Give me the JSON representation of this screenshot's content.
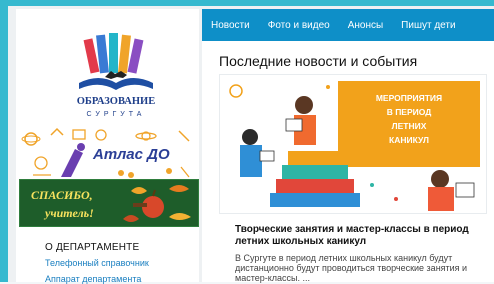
{
  "nav": {
    "items": [
      "Новости",
      "Фото и видео",
      "Анонсы",
      "Пишут дети"
    ]
  },
  "logo": {
    "text_line1": "ОБРАЗОВАНИЕ",
    "text_line2": "СУРГУТА"
  },
  "banners": {
    "atlas": "Атлас ДО",
    "thanks_line1": "СПАСИБО,",
    "thanks_line2": "учитель!"
  },
  "main": {
    "section_title": "Последние новости и события",
    "featured": {
      "image_caption_line1": "МЕРОПРИЯТИЯ",
      "image_caption_line2": "В ПЕРИОД",
      "image_caption_line3": "ЛЕТНИХ",
      "image_caption_line4": "КАНИКУЛ",
      "headline": "Творческие занятия и мастер-классы в период летних школьных каникул",
      "snippet": "В Сургуте в период летних школьных каникул будут дистанционно будут проводиться творческие занятия и мастер-классы. ..."
    }
  },
  "department": {
    "heading": "О ДЕПАРТАМЕНТЕ",
    "links": [
      "Телефонный справочник",
      "Аппарат департамента"
    ]
  },
  "colors": {
    "nav_bg": "#0e8fc8",
    "accent_cyan": "#36b9cf",
    "link": "#1a7fc0",
    "caption_orange": "#f2a21b"
  }
}
